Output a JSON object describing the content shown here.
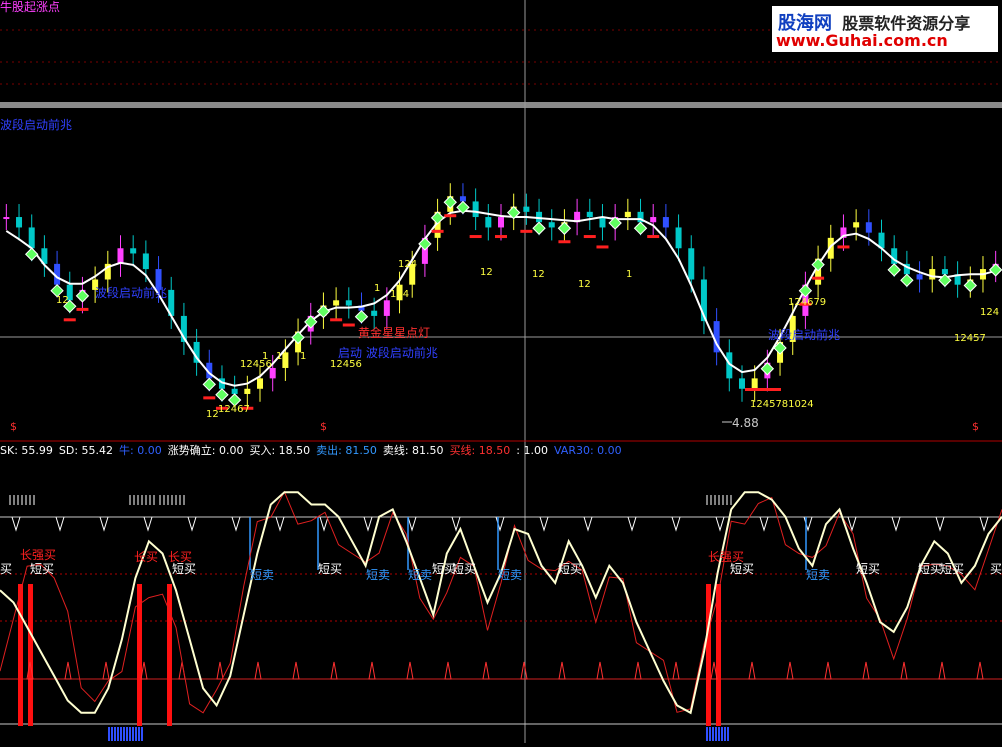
{
  "title": "牛股起涨点",
  "watermark": {
    "brand": "股海网",
    "slogan": "股票软件资源分享",
    "url": "www.Guhai.com.cn"
  },
  "upper_labels": {
    "signal_text": "波段启动前兆",
    "gold_star": "黄金星星点灯",
    "wave_start": "启动 波段启动前兆",
    "low_price": "4.88",
    "num_tags": [
      "12",
      "12467",
      "12456",
      "1",
      "1",
      "1",
      "124",
      "12456",
      "1",
      "12",
      "124",
      "12",
      "12",
      "12",
      "1",
      "124679",
      "12457",
      "124",
      "1245781024"
    ]
  },
  "indicator_bar": {
    "items": [
      {
        "label": "SK: 55.99",
        "color": "#ffffff"
      },
      {
        "label": "SD: 55.42",
        "color": "#ffffff"
      },
      {
        "label": "牛: 0.00",
        "color": "#3060ff"
      },
      {
        "label": "涨势确立: 0.00",
        "color": "#ffffff"
      },
      {
        "label": "买入: 18.50",
        "color": "#ffffff"
      },
      {
        "label": "卖出: 81.50",
        "color": "#3399ff"
      },
      {
        "label": "卖线: 81.50",
        "color": "#ffffff"
      },
      {
        "label": "买线: 18.50",
        "color": "#ff3030"
      },
      {
        "label": ": 1.00",
        "color": "#ffffff"
      },
      {
        "label": "VAR30: 0.00",
        "color": "#3060ff"
      }
    ]
  },
  "lower_labels": {
    "long_buy": "长买",
    "long_strong_buy": "长强买",
    "short_buy": "短买",
    "short_sell": "短卖",
    "buy_partial": "买"
  },
  "chart_data": [
    {
      "type": "candlestick",
      "title": "牛股起涨点",
      "annotations": [
        "波段启动前兆",
        "黄金星星点灯",
        "4.88"
      ],
      "min_price_label": 4.88,
      "close_series": [
        8.2,
        8.0,
        7.6,
        7.3,
        6.9,
        6.6,
        6.8,
        7.0,
        7.3,
        7.6,
        7.5,
        7.2,
        6.8,
        6.3,
        5.8,
        5.4,
        5.1,
        4.9,
        4.8,
        4.9,
        5.1,
        5.3,
        5.6,
        6.0,
        6.3,
        6.5,
        6.6,
        6.5,
        6.4,
        6.3,
        6.6,
        6.9,
        7.3,
        7.8,
        8.3,
        8.6,
        8.5,
        8.2,
        8.0,
        8.2,
        8.4,
        8.3,
        8.1,
        8.0,
        8.1,
        8.3,
        8.2,
        8.0,
        8.2,
        8.3,
        8.1,
        8.2,
        8.0,
        7.6,
        7.0,
        6.2,
        5.6,
        5.1,
        4.9,
        5.1,
        5.4,
        5.8,
        6.3,
        6.9,
        7.4,
        7.8,
        8.0,
        8.1,
        7.9,
        7.6,
        7.3,
        7.1,
        7.0,
        7.2,
        7.1,
        6.9,
        7.0,
        7.2,
        7.3
      ]
    },
    {
      "type": "line",
      "series": [
        {
          "name": "SK",
          "values": [
            30,
            45,
            60,
            72,
            60,
            40,
            20,
            8,
            10,
            25,
            45,
            60,
            55,
            35,
            15,
            5,
            8,
            30,
            55,
            75,
            88,
            92,
            90,
            85,
            82,
            80,
            70,
            60,
            75,
            85,
            70,
            55,
            40,
            62,
            70,
            60,
            45,
            58,
            75,
            72,
            62,
            55,
            70,
            60,
            50,
            62,
            55,
            40,
            30,
            20,
            10,
            5,
            25,
            55,
            80,
            90,
            92,
            88,
            80,
            70,
            62,
            78,
            85,
            70,
            55,
            40,
            35,
            45,
            60,
            72,
            65,
            55,
            60,
            70,
            80
          ]
        },
        {
          "name": "SD",
          "values": [
            55,
            50,
            40,
            30,
            20,
            10,
            5,
            5,
            15,
            35,
            60,
            75,
            70,
            55,
            35,
            15,
            8,
            20,
            45,
            70,
            90,
            95,
            95,
            90,
            90,
            85,
            75,
            65,
            85,
            88,
            75,
            60,
            45,
            70,
            80,
            65,
            50,
            62,
            80,
            78,
            65,
            58,
            75,
            65,
            52,
            65,
            58,
            42,
            30,
            18,
            8,
            5,
            30,
            62,
            88,
            95,
            95,
            92,
            85,
            72,
            65,
            82,
            88,
            72,
            58,
            42,
            38,
            48,
            65,
            75,
            70,
            58,
            65,
            78,
            85
          ]
        }
      ],
      "ylim": [
        0,
        100
      ],
      "levels": {
        "buy_line": 18.5,
        "sell_line": 81.5
      },
      "signals": [
        "长买",
        "长强买",
        "短买",
        "短卖"
      ]
    }
  ]
}
